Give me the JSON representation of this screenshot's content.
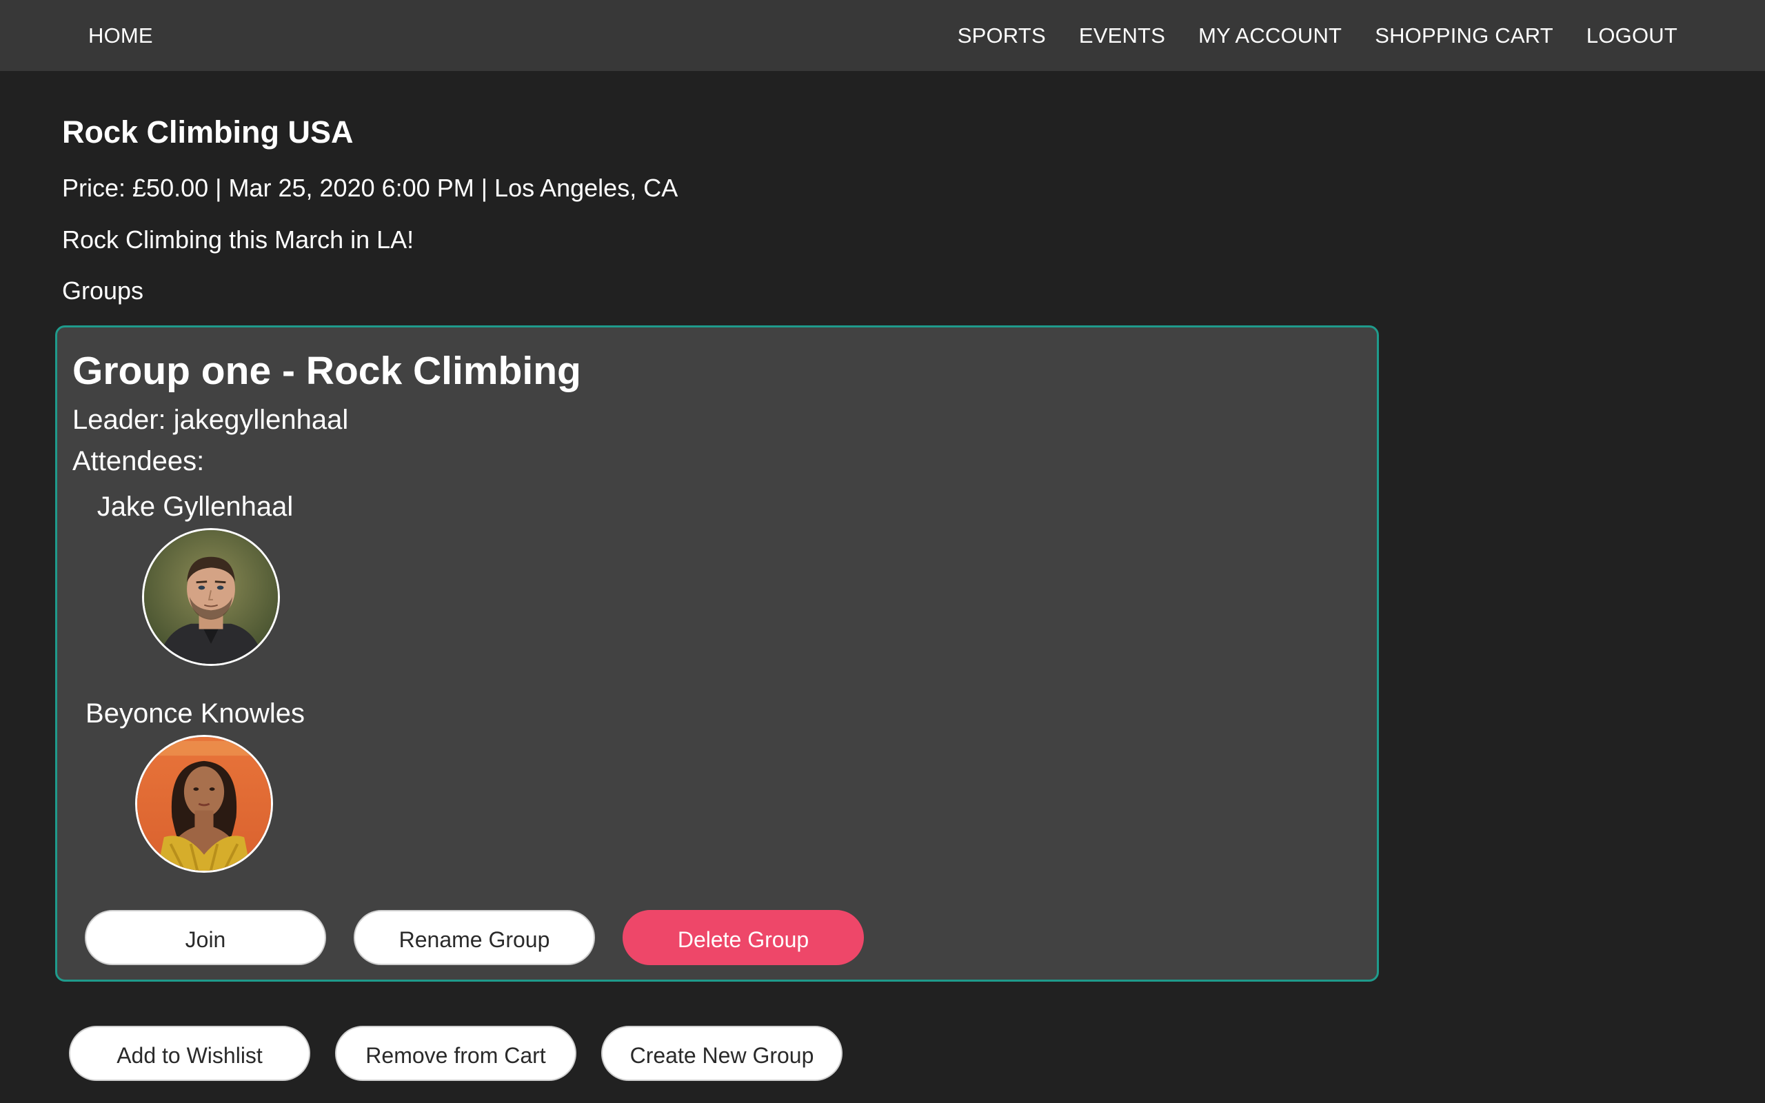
{
  "nav": {
    "home": "HOME",
    "sports": "SPORTS",
    "events": "EVENTS",
    "my_account": "MY ACCOUNT",
    "shopping_cart": "SHOPPING CART",
    "logout": "LOGOUT"
  },
  "event": {
    "title": "Rock Climbing USA",
    "meta": "Price: £50.00 | Mar 25, 2020 6:00 PM | Los Angeles, CA",
    "description": "Rock Climbing this March in LA!",
    "groups_heading": "Groups"
  },
  "group": {
    "title": "Group one - Rock Climbing",
    "leader_label": "Leader: ",
    "leader_name": "jakegyllenhaal",
    "attendees_label": "Attendees:",
    "attendees": [
      {
        "name": "Jake Gyllenhaal"
      },
      {
        "name": "Beyonce Knowles"
      }
    ],
    "buttons": {
      "join": "Join",
      "rename": "Rename Group",
      "delete": "Delete Group"
    }
  },
  "actions": {
    "add_wishlist": "Add to Wishlist",
    "remove_cart": "Remove from Cart",
    "create_group": "Create New Group"
  },
  "colors": {
    "page_background": "#212121",
    "nav_background": "#383838",
    "card_background": "#424242",
    "card_border": "#1f9b8c",
    "danger": "#ee4769"
  }
}
